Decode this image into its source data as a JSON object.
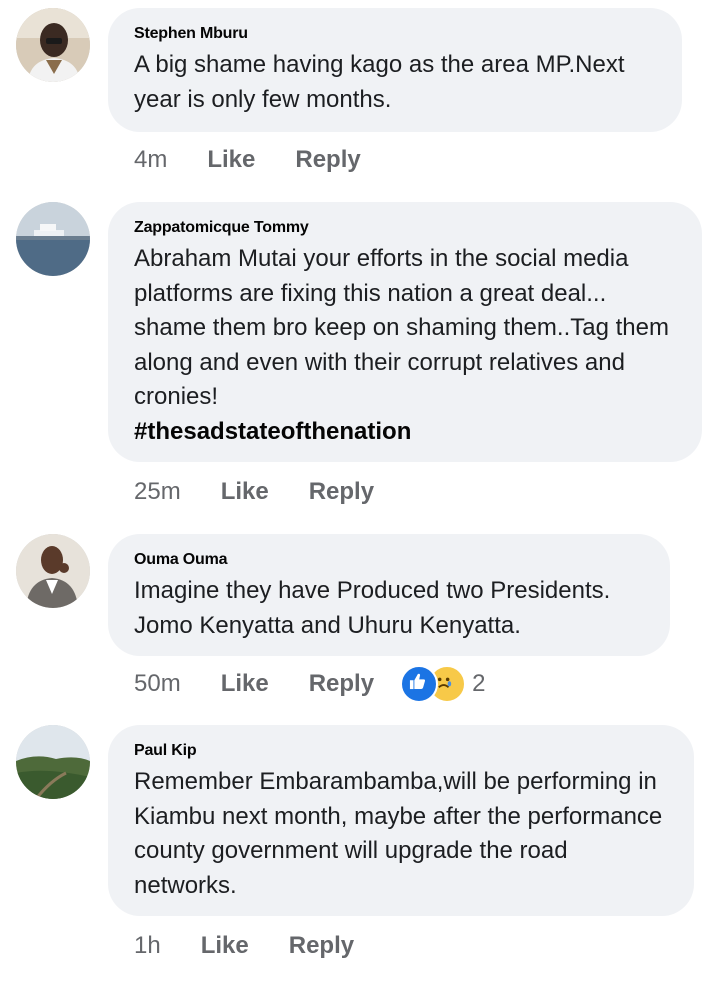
{
  "comments": [
    {
      "author": "Stephen Mburu",
      "text": "A big shame having kago as the area MP.Next year is only few months.",
      "time": "4m",
      "like_label": "Like",
      "reply_label": "Reply"
    },
    {
      "author": "Zappatomicque Tommy",
      "text": "Abraham Mutai your efforts in the social media platforms are fixing this nation a great deal... shame them bro keep on shaming them..Tag them along and even with their corrupt relatives and cronies!",
      "hashtag": "#thesadstateofthenation",
      "time": "25m",
      "like_label": "Like",
      "reply_label": "Reply"
    },
    {
      "author": "Ouma Ouma",
      "text": "Imagine they have Produced two Presidents. Jomo Kenyatta and Uhuru Kenyatta.",
      "time": "50m",
      "like_label": "Like",
      "reply_label": "Reply",
      "reaction_count": "2",
      "reaction_icons": [
        "like-icon",
        "sad-face-icon"
      ]
    },
    {
      "author": "Paul Kip",
      "text": "Remember Embarambamba,will be performing in Kiambu next month, maybe after the performance county government will upgrade the road networks.",
      "time": "1h",
      "like_label": "Like",
      "reply_label": "Reply"
    }
  ],
  "colors": {
    "bubble_bg": "#f0f2f5",
    "meta_text": "#65676b",
    "like_reaction": "#1b74e4",
    "sad_reaction": "#f7c948"
  }
}
